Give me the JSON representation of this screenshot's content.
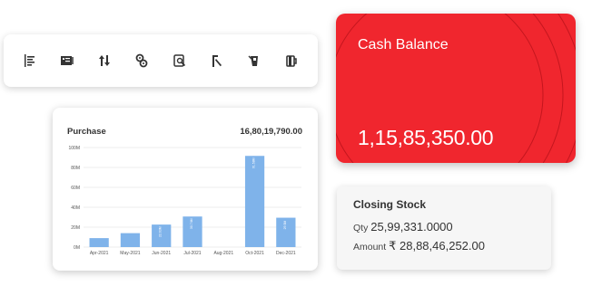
{
  "toolbar": {
    "icons": [
      "report-icon",
      "ledger-icon",
      "sort-icon",
      "gears-icon",
      "search-doc-icon",
      "pen-icon",
      "glass-icon",
      "mug-icon"
    ]
  },
  "purchase": {
    "title": "Purchase",
    "total": "16,80,19,790.00",
    "chart_data": {
      "type": "bar",
      "categories": [
        "Apr-2021",
        "May-2021",
        "Jun-2021",
        "Jul-2021",
        "Aug-2021",
        "Oct-2021",
        "Dec-2021"
      ],
      "values": [
        9,
        14,
        22.6,
        30.7,
        0,
        91.6,
        29.5
      ],
      "bar_labels": [
        "",
        "",
        "22.63M",
        "30.74M",
        "",
        "91.58M",
        "29.5M"
      ],
      "yticks": [
        "0M",
        "20M",
        "40M",
        "60M",
        "80M",
        "100M"
      ],
      "ylim": [
        0,
        100
      ],
      "title": "",
      "xlabel": "",
      "ylabel": "",
      "grid": true,
      "color": "#7fb3ea"
    }
  },
  "cash": {
    "title": "Cash Balance",
    "amount": "1,15,85,350.00",
    "color": "#f0262e"
  },
  "closing": {
    "title": "Closing Stock",
    "qty_label": "Qty",
    "qty_value": "25,99,331.0000",
    "amount_label": "Amount",
    "amount_value": "₹ 28,88,46,252.00"
  }
}
